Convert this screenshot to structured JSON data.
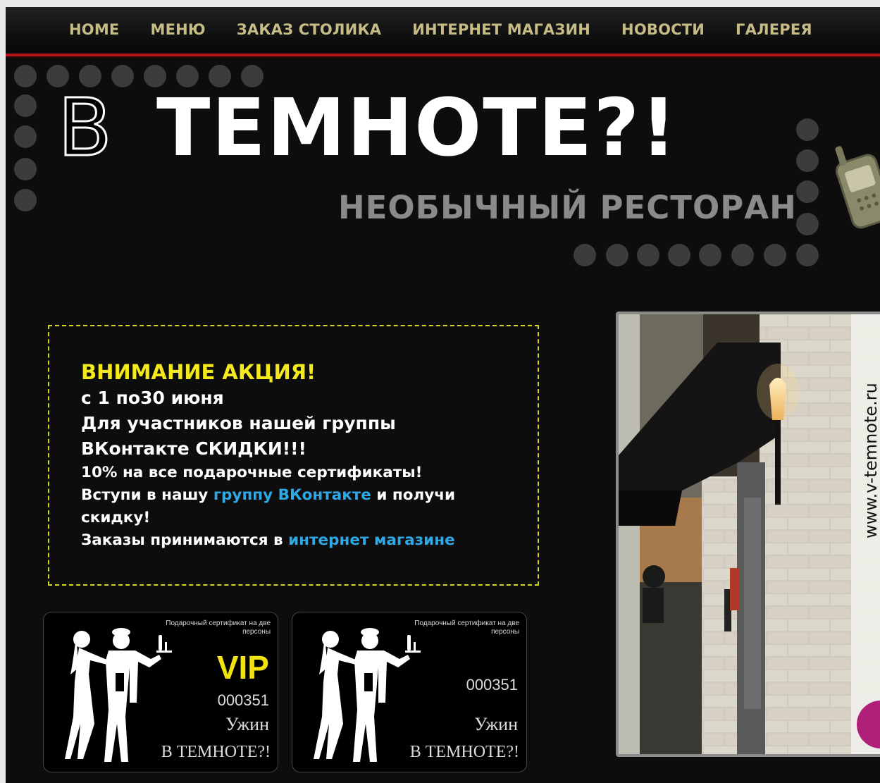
{
  "nav": {
    "items": [
      "HOME",
      "МЕНЮ",
      "ЗАКАЗ СТОЛИКА",
      "ИНТЕРНЕТ МАГАЗИН",
      "НОВОСТИ",
      "ГАЛЕРЕЯ"
    ]
  },
  "logo": {
    "b_letter": "В",
    "main": "ТЕМНОТЕ?!",
    "subtitle": "НЕОБЫЧНЫЙ РЕСТОРАН"
  },
  "promo": {
    "title": "ВНИМАНИЕ АКЦИЯ!",
    "line1": "с 1 по30 июня",
    "line2": "Для участников нашей группы",
    "line3": "ВКонтакте СКИДКИ!!!",
    "line4": "10% на все подарочные сертификаты!",
    "line5_pre": "Вступи в нашу ",
    "line5_link": "группу ВКонтакте",
    "line5_post": " и получи",
    "line6": "скидку!",
    "line7_pre": "Заказы принимаются в ",
    "line7_link": "интернет магазине"
  },
  "certificates": [
    {
      "heading": "Подарочный сертификат на две персоны",
      "vip": "VIP",
      "number": "000351",
      "line1": "Ужин",
      "line2": "В ТЕМНОТЕ?!"
    },
    {
      "heading": "Подарочный сертификат на две персоны",
      "number": "000351",
      "line1": "Ужин",
      "line2": "В ТЕМНОТЕ?!"
    }
  ],
  "photo": {
    "watermark": "www.v-temnote.ru"
  },
  "colors": {
    "nav_text": "#c7bb86",
    "nav_underline": "#b8141b",
    "promo_title": "#f4e91a",
    "promo_border": "#d9d420",
    "link": "#2fa9e6",
    "vip": "#f1e40e"
  }
}
